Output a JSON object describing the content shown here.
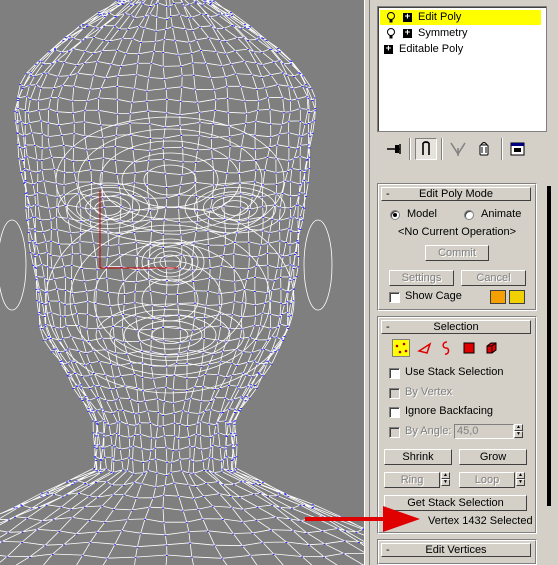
{
  "stack": {
    "items": [
      {
        "label": "Edit Poly",
        "selected": true
      },
      {
        "label": "Symmetry",
        "selected": false
      },
      {
        "label": "Editable Poly",
        "selected": false
      }
    ]
  },
  "toolbar": {
    "icons": [
      "pin-stack-icon",
      "show-end-result-icon",
      "make-unique-icon",
      "remove-modifier-icon",
      "configure-modifier-sets-icon"
    ]
  },
  "edit_poly_mode": {
    "title": "Edit Poly Mode",
    "model_label": "Model",
    "animate_label": "Animate",
    "mode": "Model",
    "current_operation": "<No Current Operation>",
    "commit_label": "Commit",
    "settings_label": "Settings",
    "cancel_label": "Cancel",
    "show_cage_label": "Show Cage",
    "cage_colors": [
      "#f5a000",
      "#f0d000"
    ]
  },
  "selection": {
    "title": "Selection",
    "subobject_icons": [
      "vertex-icon",
      "edge-icon",
      "border-icon",
      "polygon-icon",
      "element-icon"
    ],
    "active_subobject": "vertex-icon",
    "use_stack_selection_label": "Use Stack Selection",
    "by_vertex_label": "By Vertex",
    "ignore_backfacing_label": "Ignore Backfacing",
    "by_angle_label": "By Angle:",
    "by_angle_value": "45,0",
    "shrink_label": "Shrink",
    "grow_label": "Grow",
    "ring_label": "Ring",
    "loop_label": "Loop",
    "get_stack_selection_label": "Get Stack Selection",
    "status": "Vertex 1432 Selected"
  },
  "edit_vertices": {
    "title": "Edit Vertices"
  },
  "colors": {
    "viewport_bg": "#7f7f7f",
    "wire": "#ffffff",
    "vertex": "#2a2aff",
    "highlight": "#ffff00",
    "arrow": "#e00000"
  }
}
